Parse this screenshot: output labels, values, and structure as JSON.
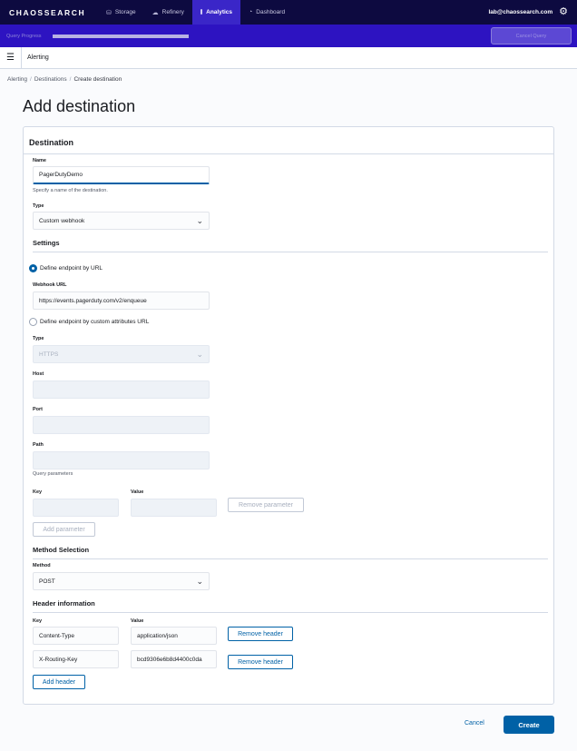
{
  "nav": {
    "brand": "CHAOSSEARCH",
    "tabs": [
      {
        "label": "Storage",
        "icon": "storage-icon",
        "glyph": "⛁"
      },
      {
        "label": "Refinery",
        "icon": "refinery-icon",
        "glyph": "☁"
      },
      {
        "label": "Analytics",
        "icon": "analytics-icon",
        "glyph": "⫾",
        "active": true
      },
      {
        "label": "Dashboard",
        "icon": "dashboard-icon",
        "glyph": "◔"
      }
    ],
    "user_email": "lab@chaossearch.com",
    "settings_glyph": "⚙"
  },
  "query": {
    "progress_label": "Query Progress",
    "progress_fraction": 1.0,
    "cancel_label": "Cancel Query"
  },
  "subheader": {
    "title": "Alerting",
    "menu_glyph": "☰"
  },
  "breadcrumb": [
    "Alerting",
    "Destinations",
    "Create destination"
  ],
  "page_title": "Add destination",
  "destination": {
    "title": "Destination",
    "name_label": "Name",
    "name_value": "PagerDutyDemo",
    "name_help": "Specify a name of the destination.",
    "type_label": "Type",
    "type_value": "Custom webhook"
  },
  "settings": {
    "title": "Settings",
    "radio_url_label": "Define endpoint by URL",
    "webhook_label": "Webhook URL",
    "webhook_value": "https://events.pagerduty.com/v2/enqueue",
    "radio_custom_label": "Define endpoint by custom attributes URL",
    "type_label": "Type",
    "type_value": "HTTPS",
    "host_label": "Host",
    "port_label": "Port",
    "path_label": "Path",
    "query_params_help": "Query parameters",
    "key_label": "Key",
    "value_label": "Value",
    "remove_param_label": "Remove parameter",
    "add_param_label": "Add parameter"
  },
  "method": {
    "title": "Method Selection",
    "label": "Method",
    "value": "POST"
  },
  "headers": {
    "title": "Header information",
    "key_label": "Key",
    "value_label": "Value",
    "rows": [
      {
        "key": "Content-Type",
        "value": "application/json",
        "remove": "Remove header"
      },
      {
        "key": "X-Routing-Key",
        "value": "bcd9306e6b8d4400c0da",
        "remove": "Remove header"
      }
    ],
    "add_label": "Add header"
  },
  "footer": {
    "cancel_label": "Cancel",
    "create_label": "Create"
  }
}
